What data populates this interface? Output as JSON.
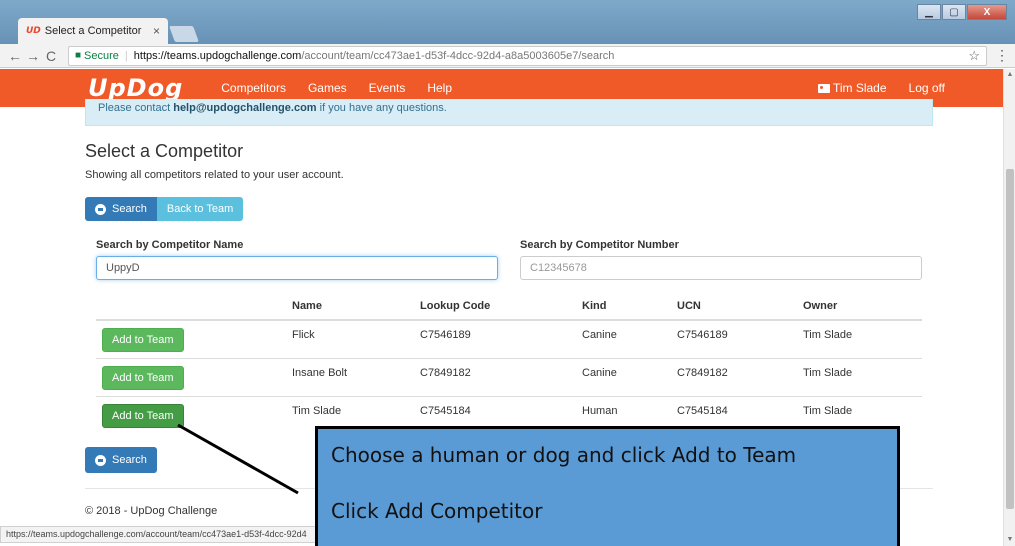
{
  "browser": {
    "tab_logo": "UD",
    "tab_title": "Select a Competitor",
    "tab_close": "×",
    "win_buttons": [
      "▁",
      "▢",
      "X"
    ],
    "back": "←",
    "forward": "→",
    "reload": "C",
    "secure_label": "Secure",
    "url_host": "https://teams.updogchallenge.com",
    "url_path": "/account/team/cc473ae1-d53f-4dcc-92d4-a8a5003605e7/search",
    "star": "☆",
    "menu": "⋮",
    "status_url": "https://teams.updogchallenge.com/account/team/cc473ae1-d53f-4dcc-92d4"
  },
  "navbar": {
    "brand": "UpDog",
    "links": [
      "Competitors",
      "Games",
      "Events",
      "Help"
    ],
    "user": "Tim Slade",
    "logoff": "Log off",
    "color": "#f05a28"
  },
  "alert": {
    "prefix": "Please contact ",
    "email": "help@updogchallenge.com",
    "suffix": " if you have any questions."
  },
  "page": {
    "title": "Select a Competitor",
    "subtitle": "Showing all competitors related to your user account.",
    "search_btn": "Search",
    "back_btn": "Back to Team",
    "name_label": "Search by Competitor Name",
    "name_value": "UppyD",
    "number_label": "Search by Competitor Number",
    "number_placeholder": "C12345678",
    "bottom_search_btn": "Search",
    "footer": "© 2018 - UpDog Challenge"
  },
  "table": {
    "headers": [
      "",
      "Name",
      "Lookup Code",
      "Kind",
      "UCN",
      "Owner"
    ],
    "add_label": "Add to Team",
    "rows": [
      {
        "name": "Flick",
        "lookup": "C7546189",
        "kind": "Canine",
        "ucn": "C7546189",
        "owner": "Tim Slade"
      },
      {
        "name": "Insane Bolt",
        "lookup": "C7849182",
        "kind": "Canine",
        "ucn": "C7849182",
        "owner": "Tim Slade"
      },
      {
        "name": "Tim Slade",
        "lookup": "C7545184",
        "kind": "Human",
        "ucn": "C7545184",
        "owner": "Tim Slade"
      }
    ]
  },
  "annotation": {
    "line1": "Choose a human or dog and click Add to Team",
    "line2": "Click Add Competitor",
    "color": "#5b9bd5"
  }
}
